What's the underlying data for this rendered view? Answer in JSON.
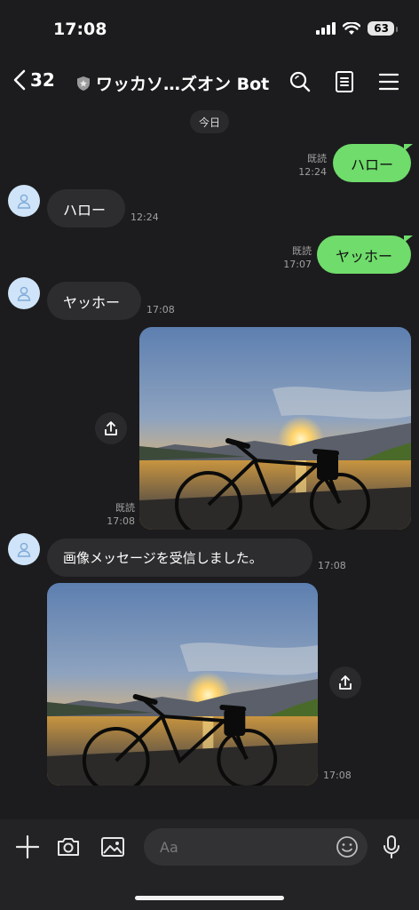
{
  "status": {
    "time": "17:08",
    "battery": "63"
  },
  "header": {
    "back_count": "32",
    "title": "ワッカソ…ズオン Bot"
  },
  "date_divider": "今日",
  "messages": [
    {
      "dir": "out",
      "text": "ハロー",
      "read": "既読",
      "time": "12:24"
    },
    {
      "dir": "in",
      "text": "ハロー",
      "time": "12:24"
    },
    {
      "dir": "out",
      "text": "ヤッホー",
      "read": "既読",
      "time": "17:07"
    },
    {
      "dir": "in",
      "text": "ヤッホー",
      "time": "17:08"
    },
    {
      "dir": "out",
      "type": "image",
      "read": "既読",
      "time": "17:08"
    },
    {
      "dir": "in",
      "text": "画像メッセージを受信しました。",
      "time": "17:08"
    },
    {
      "dir": "in",
      "type": "image",
      "time": "17:08"
    }
  ],
  "composer": {
    "placeholder": "Aa"
  },
  "colors": {
    "out_bubble": "#6fdc6b",
    "in_bubble": "#2d2d2f",
    "background": "#1c1c1e"
  },
  "icons": [
    "back-chevron-icon",
    "shield-icon",
    "search-icon",
    "notes-icon",
    "menu-icon",
    "plus-icon",
    "camera-icon",
    "image-icon",
    "emoji-icon",
    "mic-icon",
    "share-icon"
  ]
}
